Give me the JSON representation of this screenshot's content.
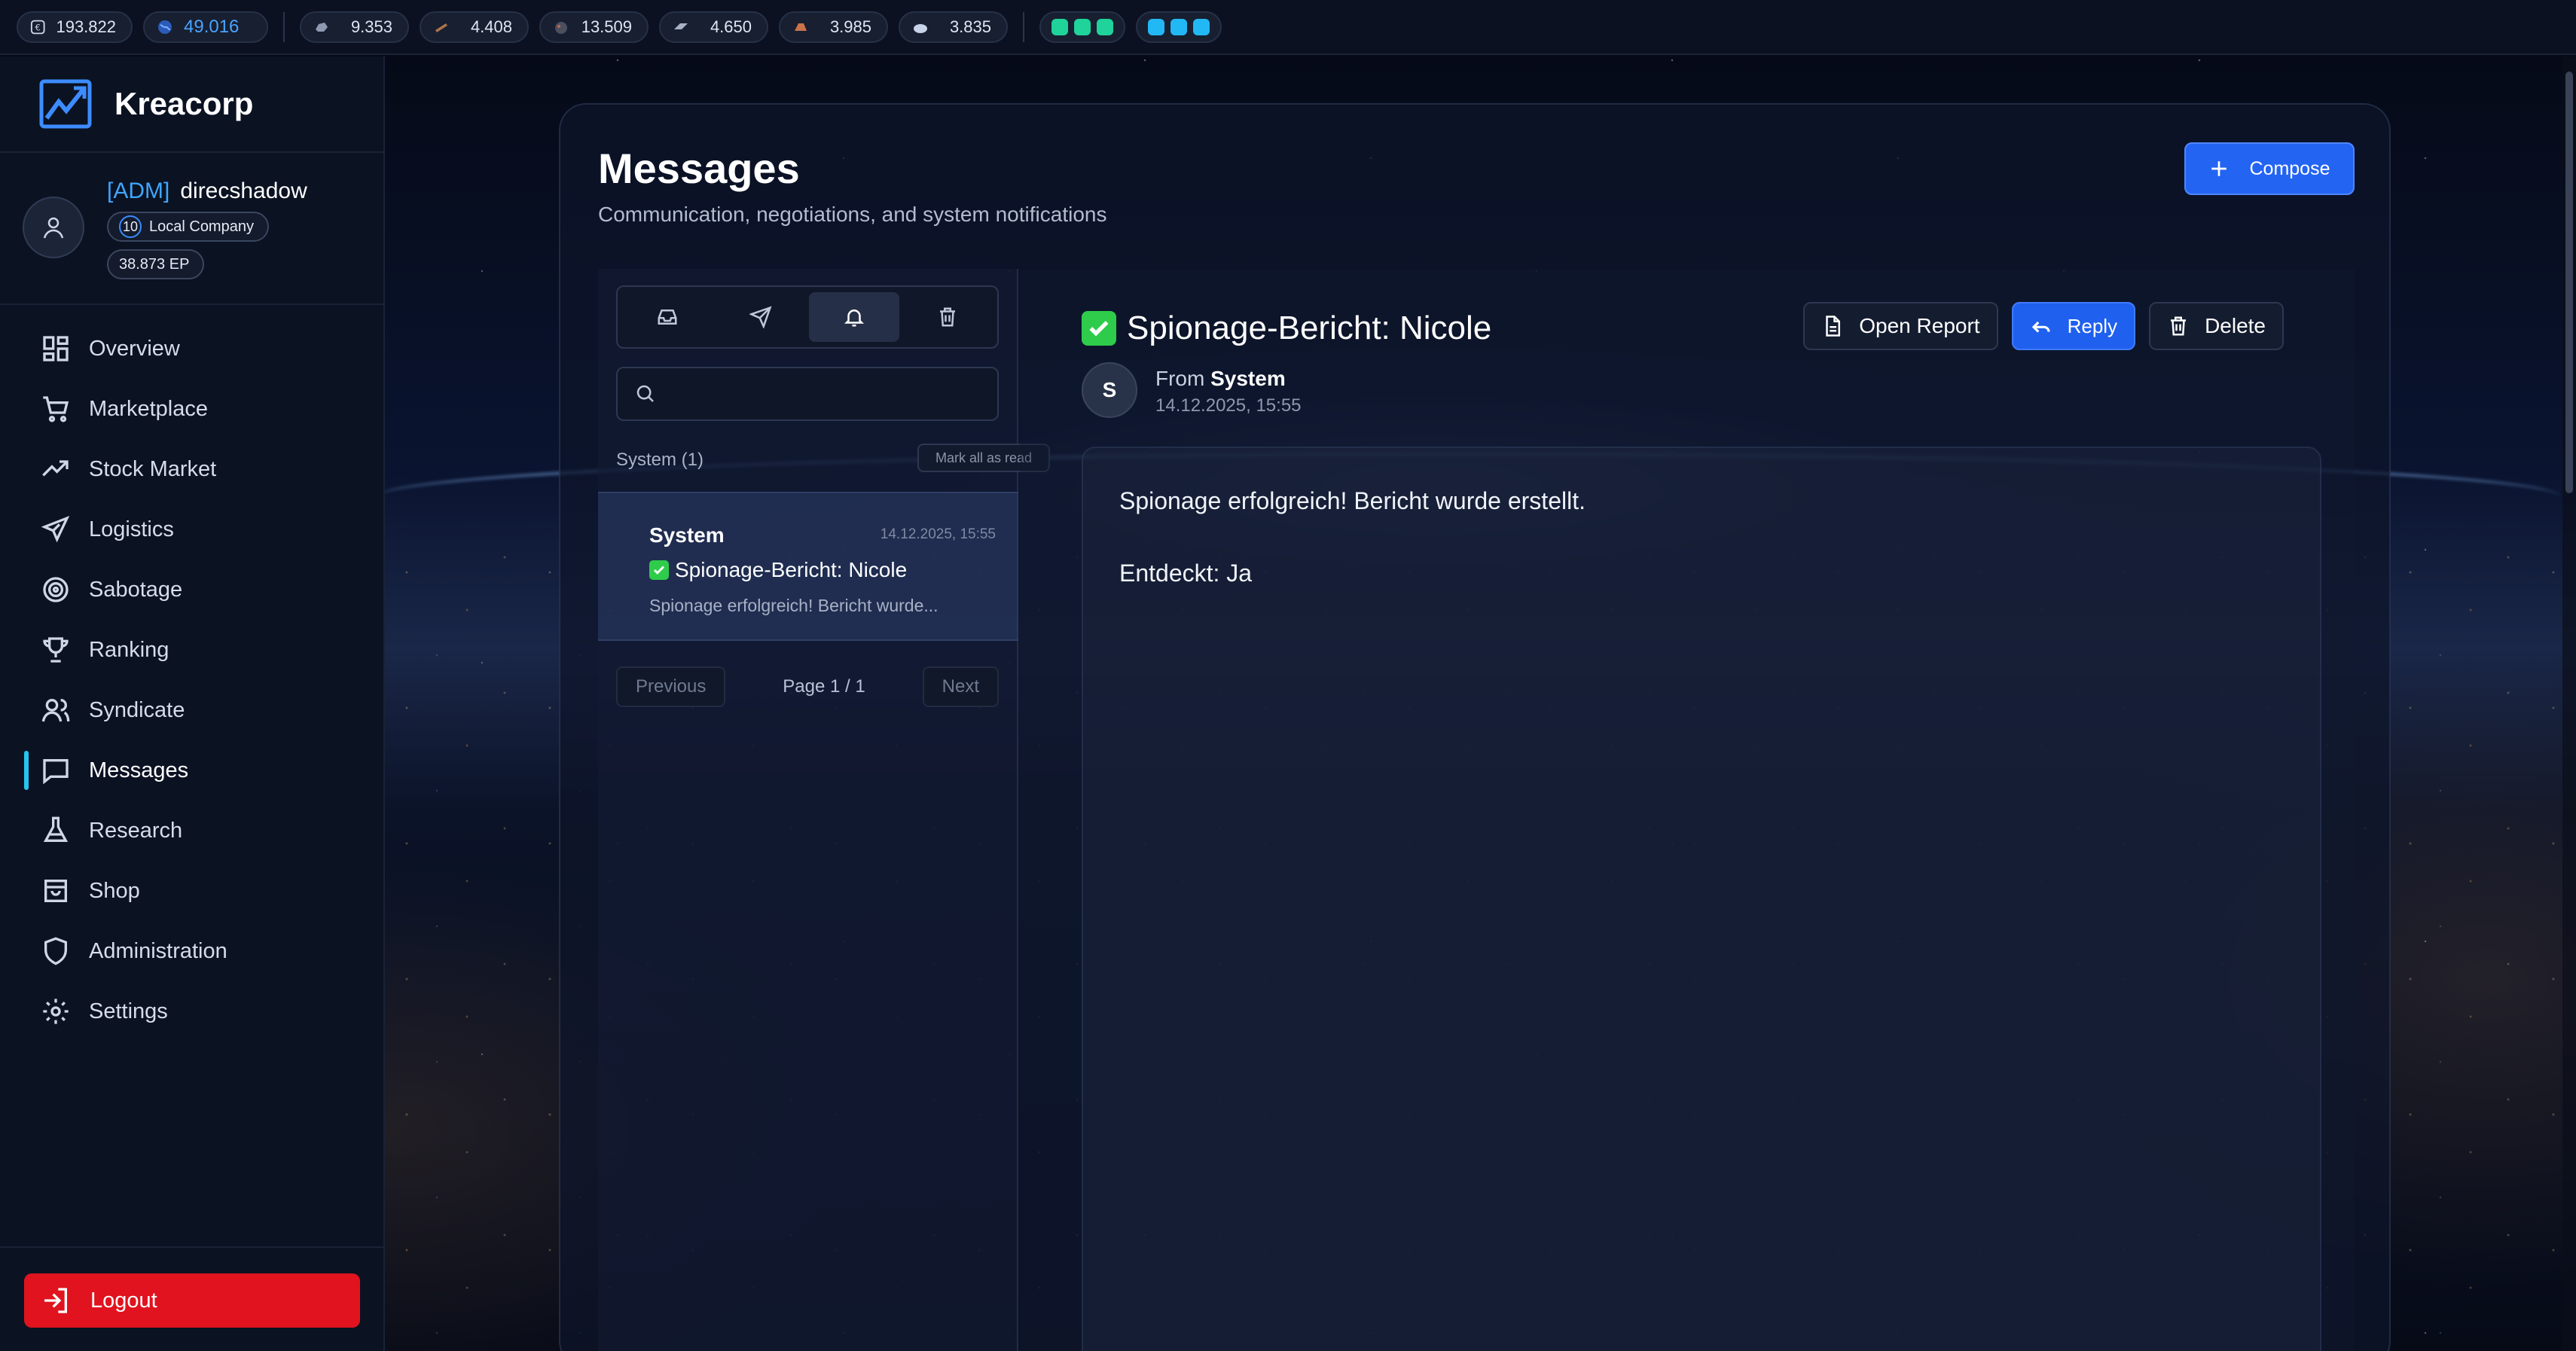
{
  "resources": {
    "money": "193.822",
    "globe": "49.016",
    "materials": [
      "9.353",
      "4.408",
      "13.509",
      "4.650",
      "3.985",
      "3.835"
    ],
    "status_dots_green": [
      "#1fd39a",
      "#1fd39a",
      "#1fd39a"
    ],
    "status_dots_blue": [
      "#22b8f5",
      "#22b8f5",
      "#22b8f5"
    ]
  },
  "brand": {
    "name": "Kreacorp"
  },
  "user": {
    "tag": "[ADM]",
    "name": "direcshadow",
    "level": "10",
    "company_type": "Local Company",
    "ep": "38.873 EP"
  },
  "nav": [
    {
      "label": "Overview",
      "icon": "grid-icon"
    },
    {
      "label": "Marketplace",
      "icon": "cart-icon"
    },
    {
      "label": "Stock Market",
      "icon": "trend-up-icon"
    },
    {
      "label": "Logistics",
      "icon": "plane-icon"
    },
    {
      "label": "Sabotage",
      "icon": "target-icon"
    },
    {
      "label": "Ranking",
      "icon": "trophy-icon"
    },
    {
      "label": "Syndicate",
      "icon": "users-icon"
    },
    {
      "label": "Messages",
      "icon": "message-icon",
      "active": true
    },
    {
      "label": "Research",
      "icon": "flask-icon"
    },
    {
      "label": "Shop",
      "icon": "shopping-bag-icon"
    },
    {
      "label": "Administration",
      "icon": "shield-icon"
    },
    {
      "label": "Settings",
      "icon": "gear-icon"
    }
  ],
  "logout_label": "Logout",
  "page": {
    "title": "Messages",
    "subtitle": "Communication, negotiations, and system notifications",
    "compose_label": "Compose"
  },
  "list": {
    "tabs": [
      "inbox-icon",
      "send-icon",
      "bell-icon",
      "trash-icon"
    ],
    "active_tab": 2,
    "search_placeholder": "",
    "folder_label": "System (1)",
    "mark_all_label": "Mark all as read",
    "items": [
      {
        "from": "System",
        "date": "14.12.2025, 15:55",
        "subject": "Spionage-Bericht: Nicole",
        "preview": "Spionage erfolgreich! Bericht wurde..."
      }
    ],
    "pager": {
      "prev": "Previous",
      "info": "Page 1 / 1",
      "next": "Next"
    }
  },
  "detail": {
    "subject": "Spionage-Bericht: Nicole",
    "actions": {
      "open_report": "Open Report",
      "reply": "Reply",
      "delete": "Delete"
    },
    "sender_initial": "S",
    "from_prefix": "From",
    "from_name": "System",
    "date": "14.12.2025, 15:55",
    "body": [
      "Spionage erfolgreich! Bericht wurde erstellt.",
      "Entdeckt: Ja"
    ]
  },
  "colors": {
    "accent": "#2364f2",
    "danger": "#e0131f",
    "active_indicator": "#27c4f0",
    "check_green": "#2ecc4a"
  }
}
